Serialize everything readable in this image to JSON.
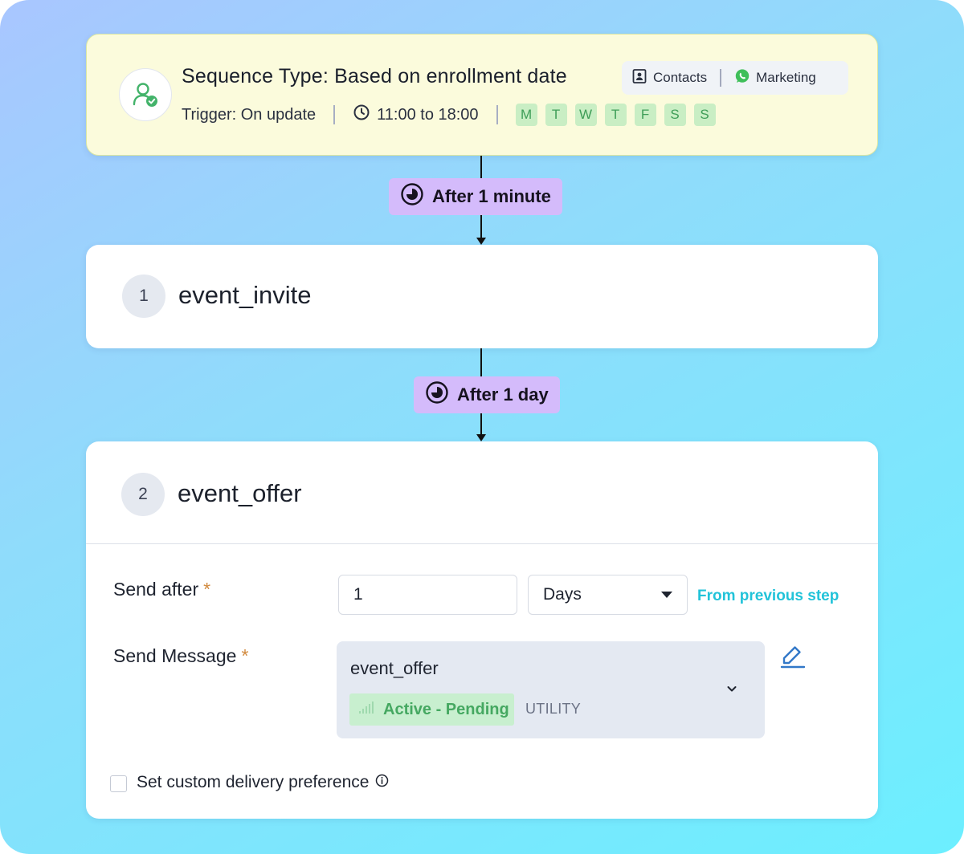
{
  "sequence": {
    "title": "Sequence Type: Based on enrollment date",
    "audience_label": "Contacts",
    "channel_label": "Marketing",
    "trigger": "Trigger: On update",
    "time_window": "11:00 to 18:00",
    "days": [
      "M",
      "T",
      "W",
      "T",
      "F",
      "S",
      "S"
    ],
    "icons": {
      "avatar": "user-check-icon",
      "audience": "contact-card-icon",
      "channel": "whatsapp-icon",
      "time": "clock-icon"
    },
    "colors": {
      "card_bg": "#fbfbdc",
      "day_bg": "#c9eec4",
      "day_text": "#3f9e58"
    }
  },
  "delays": [
    {
      "label": "After 1 minute",
      "icon": "timer-icon"
    },
    {
      "label": "After 1 day",
      "icon": "timer-icon"
    }
  ],
  "steps": [
    {
      "number": "1",
      "name": "event_invite"
    },
    {
      "number": "2",
      "name": "event_offer",
      "send_after_label": "Send after",
      "send_after_value": "1",
      "unit_selected": "Days",
      "relative_to": "From previous step",
      "send_message_label": "Send Message",
      "required_marker": "*",
      "template": {
        "name": "event_offer",
        "status": "Active - Pending",
        "category": "UTILITY"
      },
      "custom_delivery_label": "Set custom delivery preference",
      "custom_delivery_checked": false
    }
  ],
  "colors": {
    "delay_chip": "#d4bbfb",
    "link": "#22c3d9",
    "required": "#d18a3e",
    "status_bg": "#c8efcf",
    "status_text": "#45a861"
  }
}
